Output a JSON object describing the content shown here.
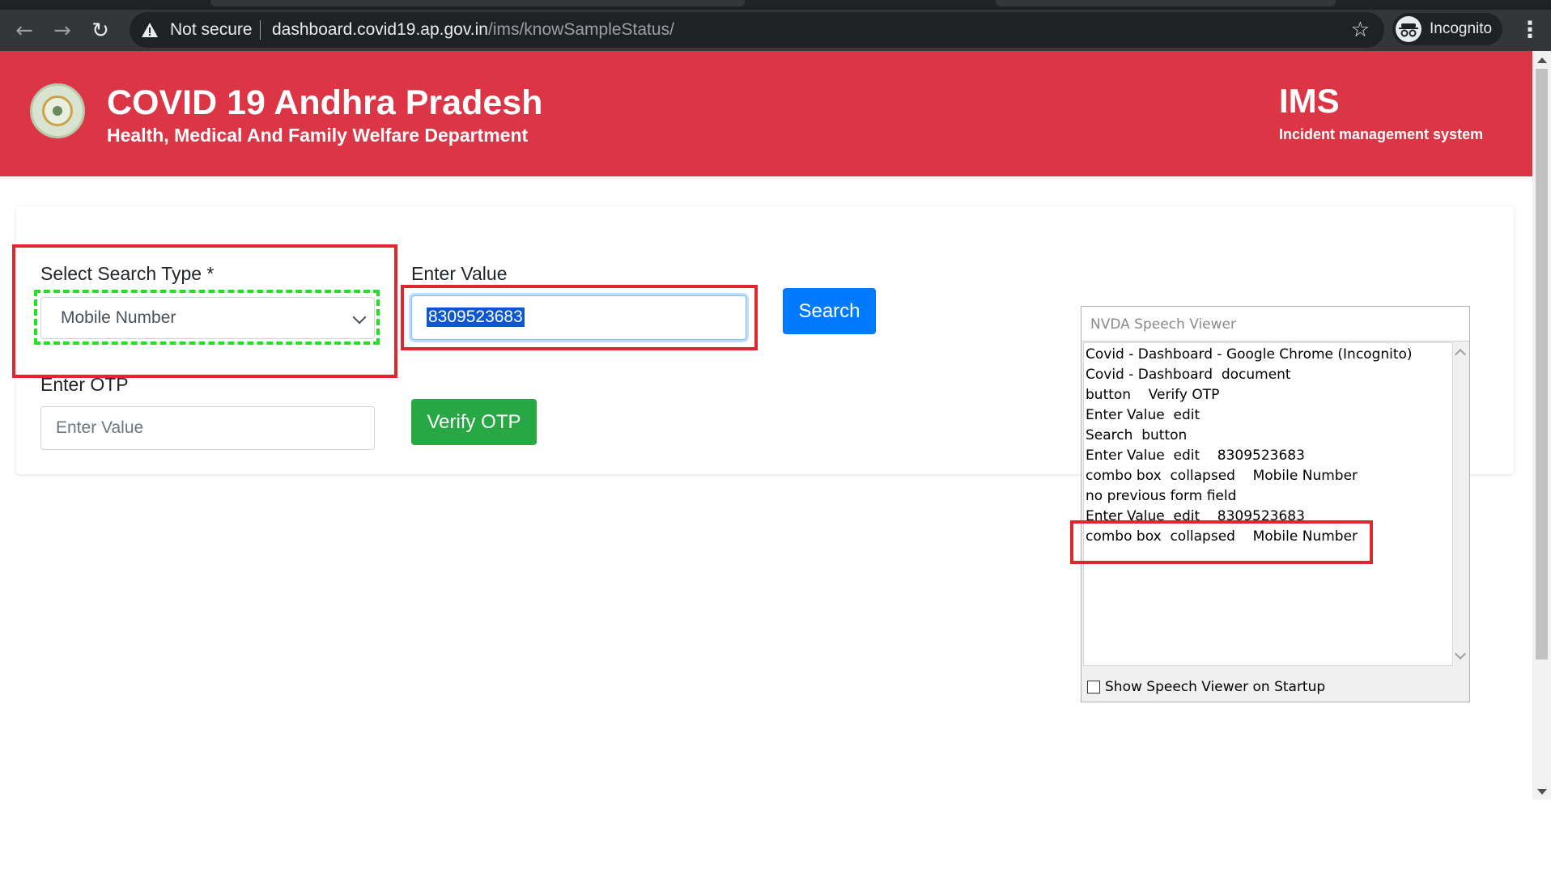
{
  "browser": {
    "security_text": "Not secure",
    "url_host": "dashboard.covid19.ap.gov.in",
    "url_path": "/ims/knowSampleStatus/",
    "profile_label": "Incognito"
  },
  "header": {
    "title": "COVID 19 Andhra Pradesh",
    "subtitle": "Health, Medical And Family Welfare Department",
    "brand": "IMS",
    "brand_sub": "Incident management system"
  },
  "form": {
    "search_type_label": "Select Search Type *",
    "search_type_value": "Mobile Number",
    "value_label": "Enter Value",
    "value_text": "8309523683",
    "search_button": "Search",
    "otp_label": "Enter OTP",
    "otp_placeholder": "Enter Value",
    "verify_button": "Verify OTP"
  },
  "nvda": {
    "title": "NVDA Speech Viewer",
    "lines": [
      "Covid - Dashboard - Google Chrome (Incognito)",
      "Covid - Dashboard  document",
      "button    Verify OTP",
      "Enter Value  edit",
      "Search  button",
      "Enter Value  edit    8309523683",
      "combo box  collapsed    Mobile Number",
      "no previous form field",
      "Enter Value  edit    8309523683",
      "combo box  collapsed    Mobile Number"
    ],
    "startup_checkbox_label": "Show Speech Viewer on Startup",
    "startup_checked": false
  },
  "colors": {
    "header_red": "#dc3545",
    "search_blue": "#007bff",
    "verify_green": "#28a745",
    "annotation_red": "#e0262e",
    "focus_green": "#22e122"
  }
}
